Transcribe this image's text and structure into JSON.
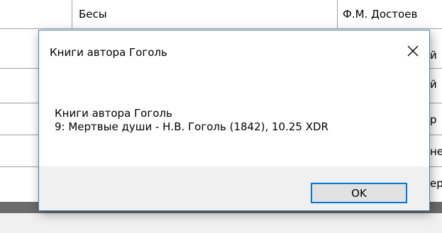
{
  "background_table": {
    "row_book": "Бесы",
    "row_author": "Ф.М. Достоев",
    "right_clipped": [
      "й",
      "й",
      "р",
      "не",
      "ер"
    ]
  },
  "dialog": {
    "title": "Книги автора Гоголь",
    "close_icon": "close-icon",
    "message_line1": "Книги автора Гоголь",
    "message_line2": "9: Мертвые души - Н.В. Гоголь (1842), 10.25 XDR",
    "ok_label": "OK"
  },
  "colors": {
    "accent": "#0078d7",
    "dialog_border": "#4d7fbf",
    "footer_bg": "#f0f0f0"
  }
}
